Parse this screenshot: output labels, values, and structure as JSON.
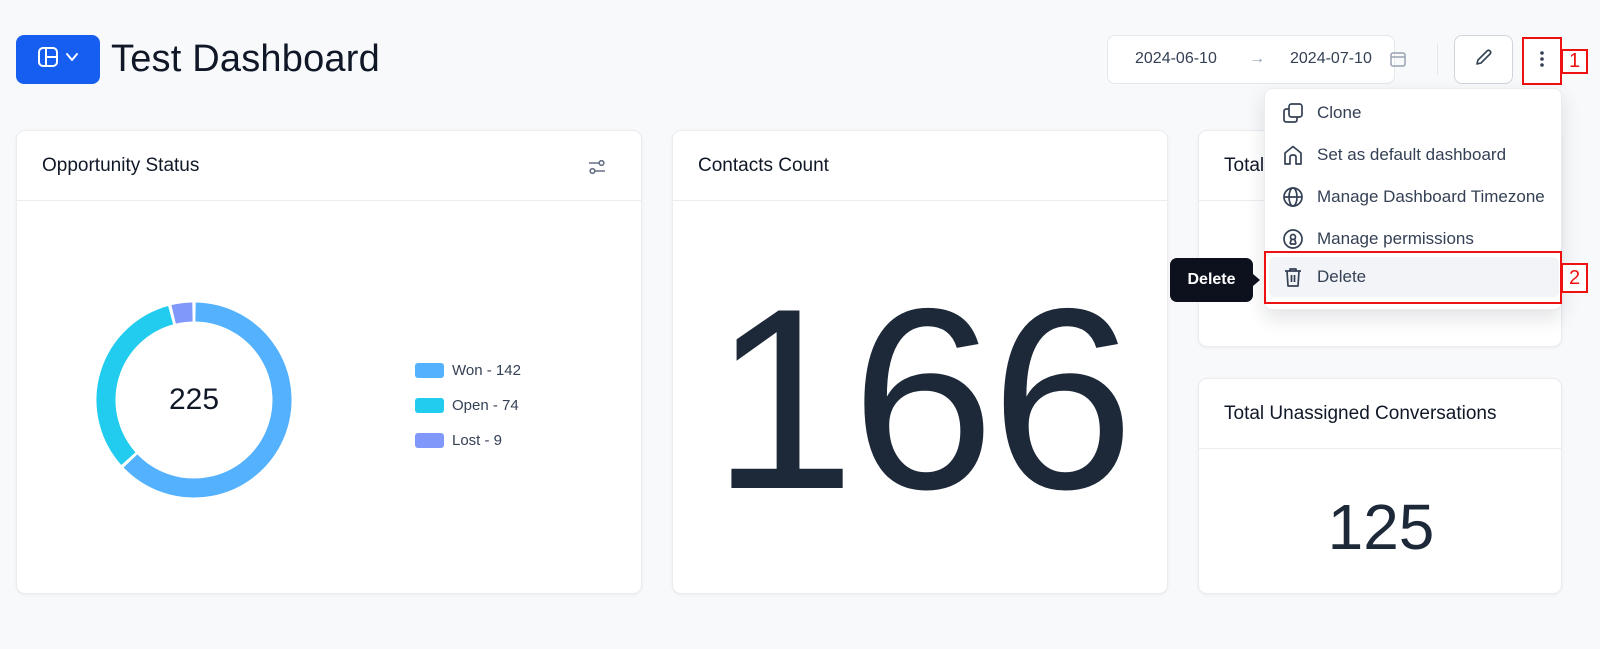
{
  "header": {
    "title": "Test Dashboard",
    "switcher_icon": "layout-grid-icon",
    "date_start": "2024-06-10",
    "date_arrow": "→",
    "date_end": "2024-07-10",
    "edit_icon": "pencil-icon",
    "more_icon": "dots-vertical-icon",
    "accent_color": "#155eef"
  },
  "annotations": {
    "callout_1": "1",
    "callout_2": "2",
    "highlight_color": "#ee1111"
  },
  "cards": {
    "opportunity": {
      "title": "Opportunity Status",
      "total": "225",
      "legend": [
        {
          "label": "Won - 142",
          "color": "#53b1fd"
        },
        {
          "label": "Open - 74",
          "color": "#22ccee"
        },
        {
          "label": "Lost - 9",
          "color": "#8098f9"
        }
      ]
    },
    "contacts": {
      "title": "Contacts Count",
      "value": "166"
    },
    "total": {
      "title": "Total"
    },
    "unassigned": {
      "title": "Total Unassigned Conversations",
      "value": "125"
    }
  },
  "chart_data": {
    "type": "pie",
    "categories": [
      "Won",
      "Open",
      "Lost"
    ],
    "values": [
      142,
      74,
      9
    ],
    "colors": [
      "#53b1fd",
      "#22ccee",
      "#8098f9"
    ],
    "center_label": "225"
  },
  "menu": {
    "items": [
      {
        "label": "Clone",
        "icon": "copy-icon"
      },
      {
        "label": "Set as default dashboard",
        "icon": "home-icon"
      },
      {
        "label": "Manage Dashboard Timezone",
        "icon": "globe-icon"
      },
      {
        "label": "Manage permissions",
        "icon": "lock-circle-icon"
      },
      {
        "label": "Delete",
        "icon": "trash-icon"
      }
    ]
  },
  "tooltip": {
    "text": "Delete"
  }
}
